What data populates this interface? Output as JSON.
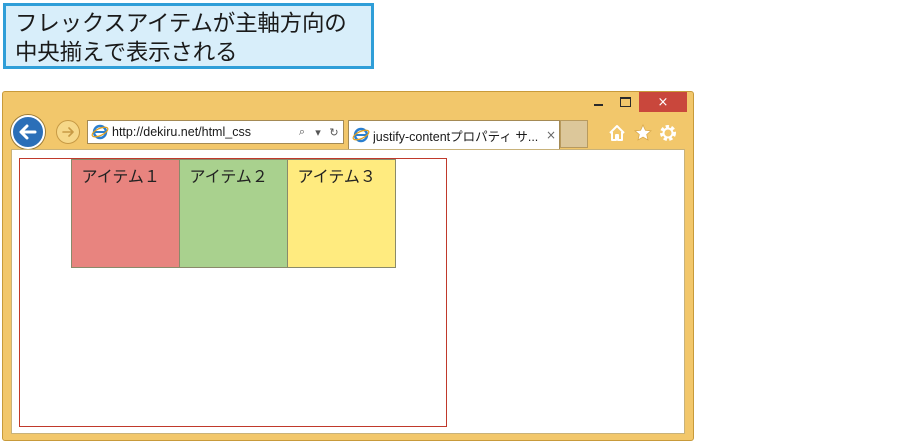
{
  "caption": {
    "line1": "フレックスアイテムが主軸方向の",
    "line2": "中央揃えで表示される"
  },
  "window": {
    "close_symbol": "×"
  },
  "address_bar": {
    "url": "http://dekiru.net/html_css",
    "search_icon": "⌕",
    "dropdown_icon": "▾",
    "refresh_icon": "↻"
  },
  "tab": {
    "title": "justify-contentプロパティ サ...",
    "close_symbol": "×"
  },
  "flex_items": [
    {
      "label": "アイテム１",
      "color": "#e8847f"
    },
    {
      "label": "アイテム２",
      "color": "#a9d18e"
    },
    {
      "label": "アイテム３",
      "color": "#ffeb7f"
    }
  ],
  "colors": {
    "window_frame": "#f2c76b",
    "close_button": "#c9473c",
    "back_button": "#2b6fb8",
    "caption_border": "#2f9ed8",
    "caption_bg": "#d8eefa",
    "container_border": "#c0392b"
  }
}
